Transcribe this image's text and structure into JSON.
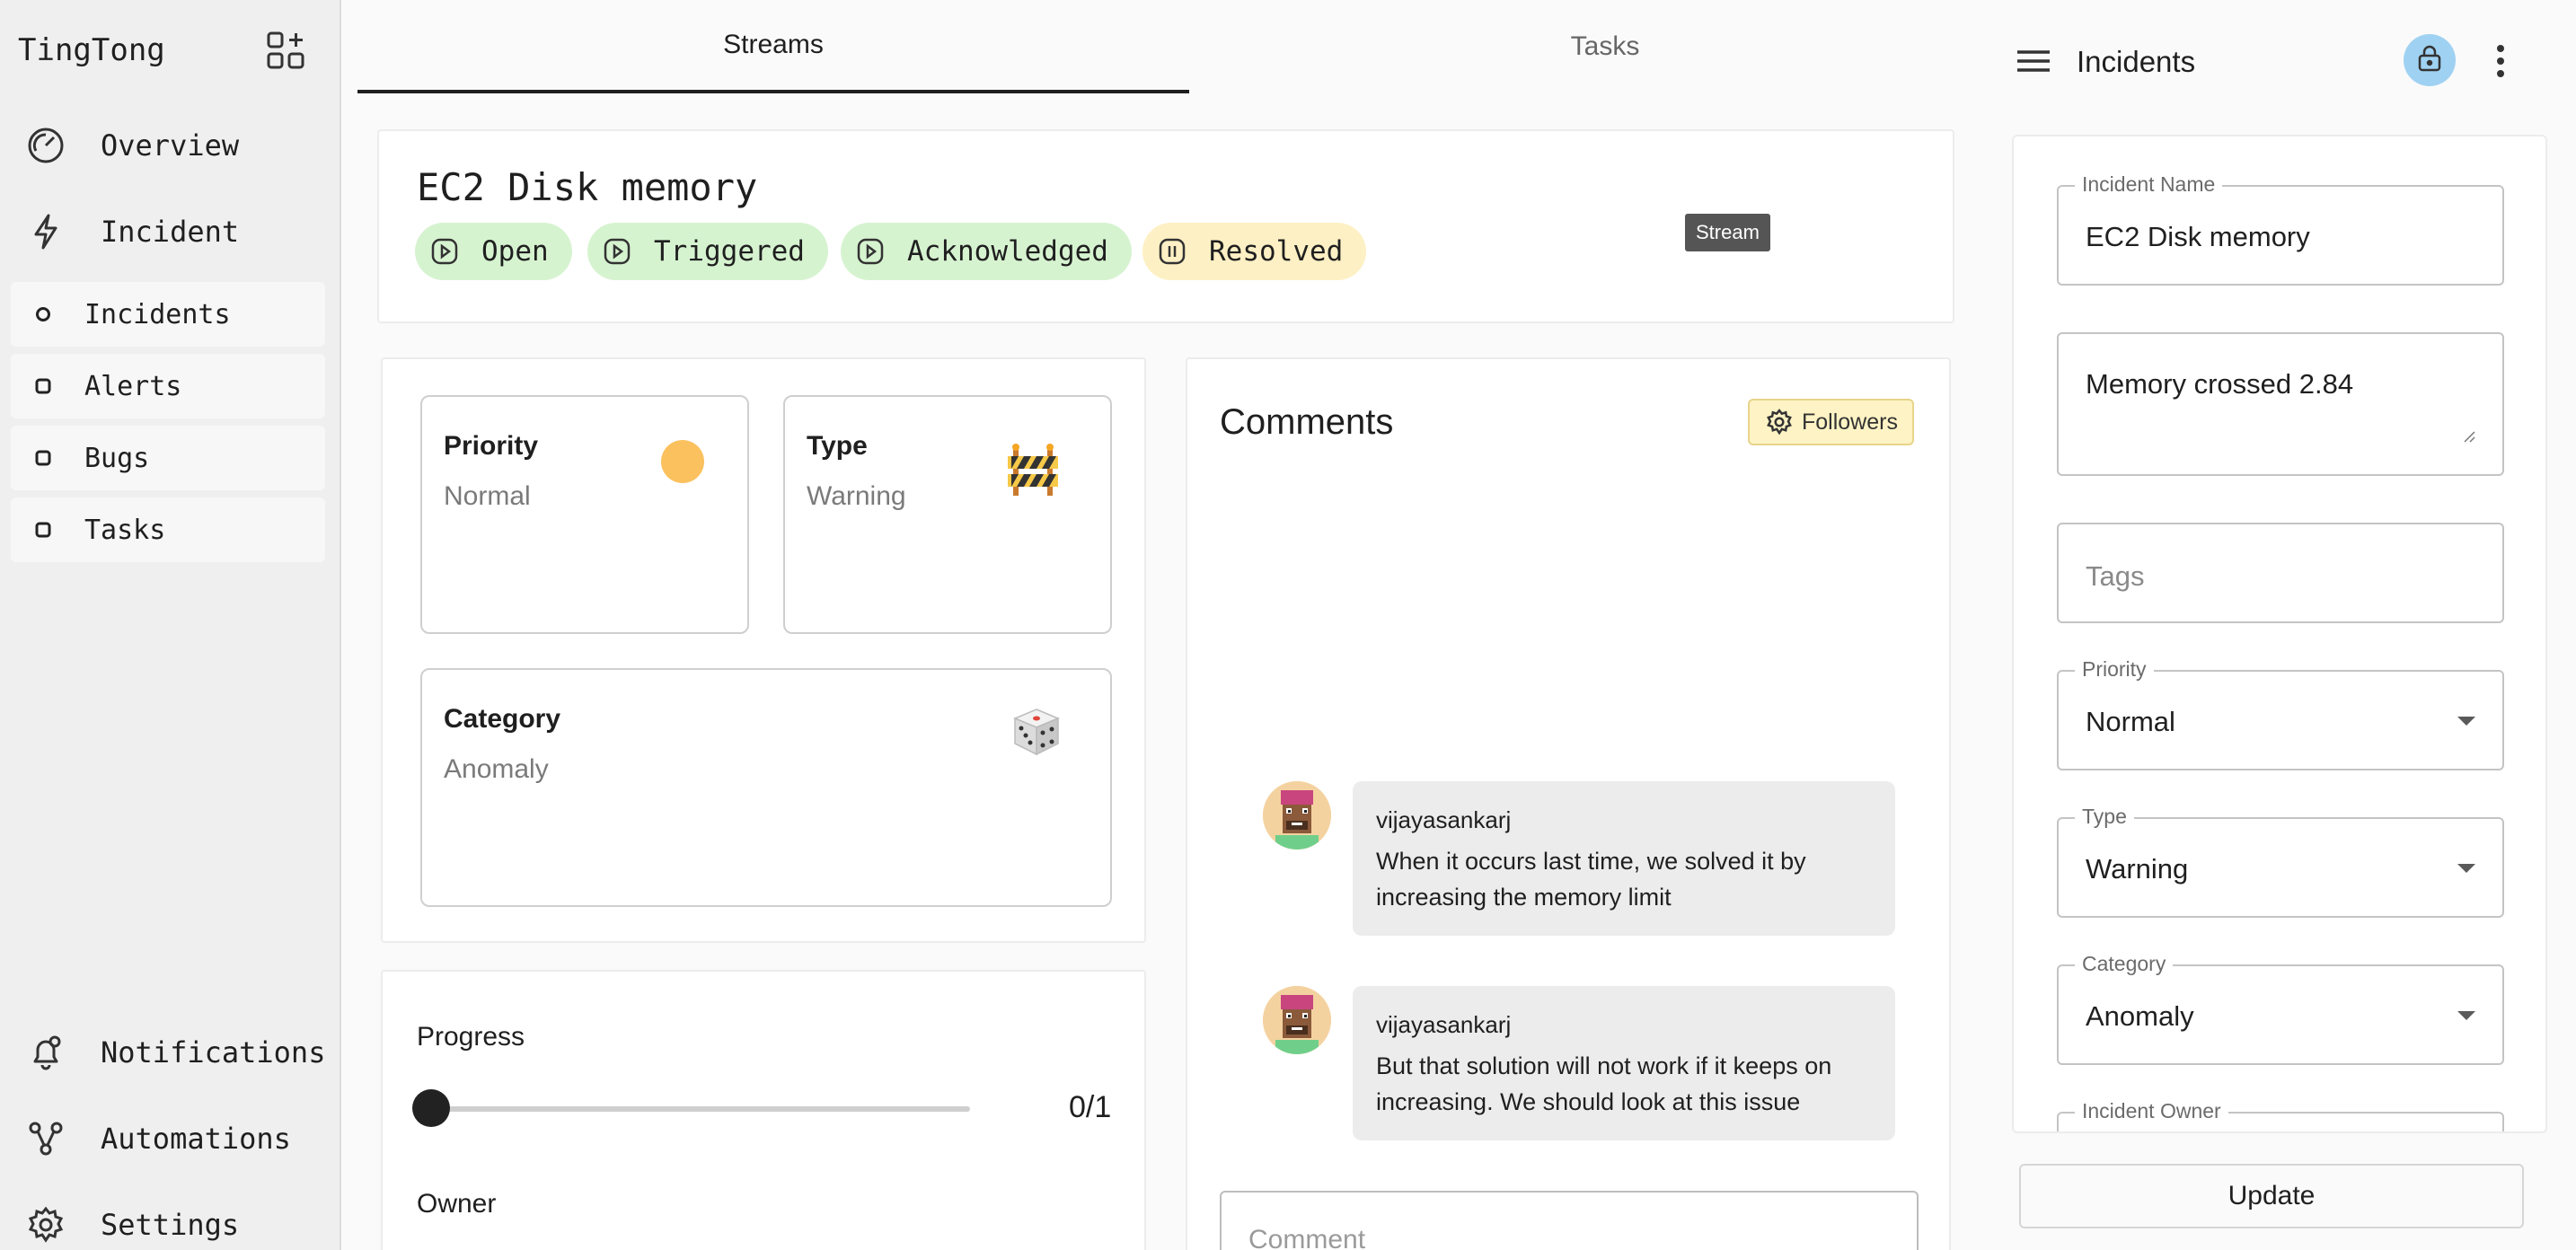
{
  "app": {
    "title": "TingTong"
  },
  "sidebar": {
    "top_items": [
      {
        "label": "Overview",
        "icon": "speedometer-icon"
      },
      {
        "label": "Incident",
        "icon": "lightning-icon"
      }
    ],
    "sub_items": [
      {
        "label": "Incidents",
        "icon": "circle-icon"
      },
      {
        "label": "Alerts",
        "icon": "square-icon"
      },
      {
        "label": "Bugs",
        "icon": "square-icon"
      },
      {
        "label": "Tasks",
        "icon": "square-icon"
      }
    ],
    "bottom_items": [
      {
        "label": "Notifications",
        "icon": "bell-icon"
      },
      {
        "label": "Automations",
        "icon": "workflow-icon"
      },
      {
        "label": "Settings",
        "icon": "gear-icon"
      }
    ]
  },
  "tabs": [
    {
      "label": "Streams",
      "active": true
    },
    {
      "label": "Tasks",
      "active": false
    }
  ],
  "incident": {
    "title": "EC2 Disk memory",
    "states": [
      {
        "label": "Open",
        "color": "#d6f3d0"
      },
      {
        "label": "Triggered",
        "color": "#d6f3d0"
      },
      {
        "label": "Acknowledged",
        "color": "#d6f3d0"
      },
      {
        "label": "Resolved",
        "color": "#fdf0c4"
      }
    ],
    "tooltip": "Stream"
  },
  "info": {
    "priority": {
      "title": "Priority",
      "value": "Normal",
      "indicator_color": "#fbc15e"
    },
    "type": {
      "title": "Type",
      "value": "Warning",
      "icon": "construction-barrier-icon"
    },
    "category": {
      "title": "Category",
      "value": "Anomaly",
      "icon": "dice-icon"
    }
  },
  "progress": {
    "label": "Progress",
    "value_text": "0/1",
    "fraction": 0,
    "owner_label": "Owner"
  },
  "comments": {
    "title": "Comments",
    "followers_label": "Followers",
    "items": [
      {
        "author": "vijayasankarj",
        "lines": [
          "When it occurs last time, we solved it by",
          "increasing the memory limit"
        ]
      },
      {
        "author": "vijayasankarj",
        "lines": [
          "But that solution will not work if it keeps on",
          "increasing. We should look at this issue"
        ]
      }
    ],
    "input_placeholder": "Comment"
  },
  "right_panel": {
    "title": "Incidents",
    "fields": {
      "name": {
        "label": "Incident Name",
        "value": "EC2 Disk memory"
      },
      "description": {
        "value": "Memory crossed 2.84"
      },
      "tags": {
        "placeholder": "Tags"
      },
      "priority": {
        "label": "Priority",
        "value": "Normal"
      },
      "type": {
        "label": "Type",
        "value": "Warning"
      },
      "category": {
        "label": "Category",
        "value": "Anomaly"
      },
      "owner": {
        "label": "Incident Owner"
      }
    },
    "update_label": "Update"
  }
}
